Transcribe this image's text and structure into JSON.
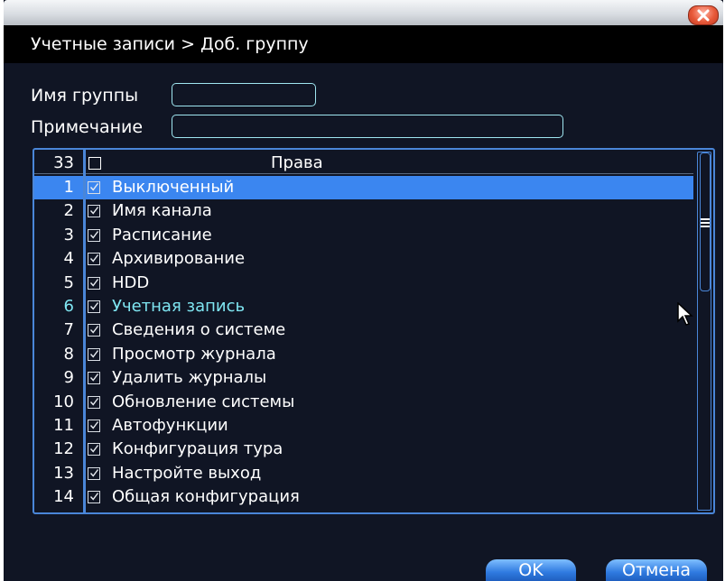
{
  "dialog": {
    "title": "Учетные записи > Доб. группу"
  },
  "form": {
    "group_name_label": "Имя группы",
    "group_name_value": "",
    "note_label": "Примечание",
    "note_value": ""
  },
  "permissions": {
    "count": "33",
    "header": "Права",
    "rows": [
      {
        "num": "1",
        "label": "Выключенный",
        "checked": true
      },
      {
        "num": "2",
        "label": "Имя канала",
        "checked": true
      },
      {
        "num": "3",
        "label": "Расписание",
        "checked": true
      },
      {
        "num": "4",
        "label": "Архивирование",
        "checked": true
      },
      {
        "num": "5",
        "label": "HDD",
        "checked": true
      },
      {
        "num": "6",
        "label": "Учетная запись",
        "checked": true
      },
      {
        "num": "7",
        "label": "Сведения о системе",
        "checked": true
      },
      {
        "num": "8",
        "label": "Просмотр журнала",
        "checked": true
      },
      {
        "num": "9",
        "label": "Удалить журналы",
        "checked": true
      },
      {
        "num": "10",
        "label": "Обновление системы",
        "checked": true
      },
      {
        "num": "11",
        "label": "Автофункции",
        "checked": true
      },
      {
        "num": "12",
        "label": "Конфигурация тура",
        "checked": true
      },
      {
        "num": "13",
        "label": "Настройте выход",
        "checked": true
      },
      {
        "num": "14",
        "label": "Общая конфигурация",
        "checked": true
      }
    ]
  },
  "buttons": {
    "ok": "OK",
    "cancel": "Отмена"
  },
  "colors": {
    "background": "#101524",
    "header": "#000000",
    "selection": "#3b86f0",
    "accent_text": "#7fe6f2",
    "border": "#4a86d8"
  }
}
